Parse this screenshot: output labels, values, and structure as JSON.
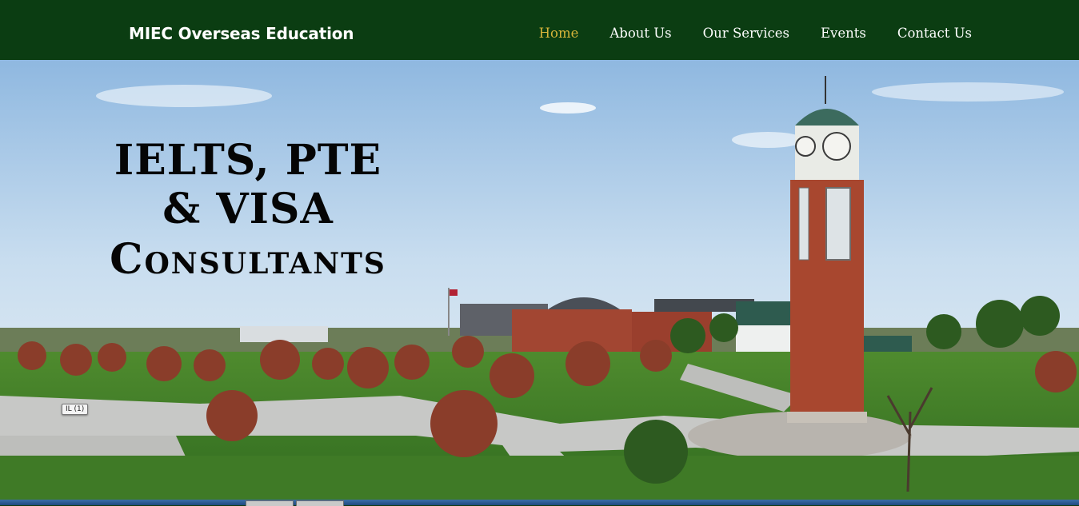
{
  "brand": {
    "name": "MIEC Overseas Education"
  },
  "nav": {
    "items": [
      {
        "label": "Home",
        "active": true
      },
      {
        "label": "About Us",
        "active": false
      },
      {
        "label": "Our Services",
        "active": false
      },
      {
        "label": "Events",
        "active": false
      },
      {
        "label": "Contact Us",
        "active": false
      }
    ]
  },
  "hero": {
    "line1": "IELTS, PTE",
    "line2": "& VISA",
    "line3": "Consultants",
    "image_description_tag": "IL (1)"
  },
  "colors": {
    "header_bg": "#0b3d12",
    "nav_active": "#d7b53a",
    "nav_text": "#ffffff",
    "headline": "#050505"
  }
}
